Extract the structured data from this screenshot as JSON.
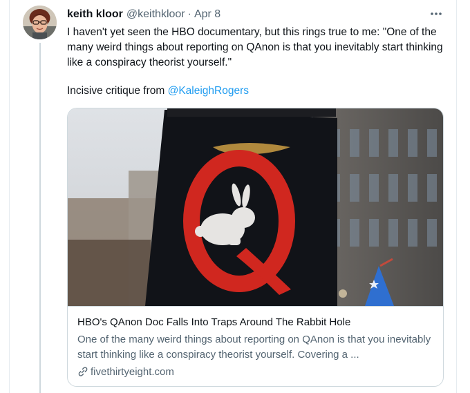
{
  "tweet": {
    "display_name": "keith kloor",
    "handle": "@keithkloor",
    "separator": "·",
    "date": "Apr 8",
    "more_icon": "more-horizontal-icon",
    "text": "I haven't yet seen the HBO documentary, but this rings  true to me: \"One of the many weird things about reporting on QAnon is that you inevitably start thinking like a conspiracy theorist yourself.\"",
    "critique_prefix": "Incisive critique from ",
    "mention": "@KaleighRogers"
  },
  "card": {
    "title": "HBO's QAnon Doc Falls Into Traps Around The Rabbit Hole",
    "description": "One of the many weird things about reporting on QAnon is that you inevitably start thinking like a conspiracy theorist yourself. Covering a ...",
    "domain": "fivethirtyeight.com",
    "link_icon": "link-icon"
  },
  "colors": {
    "link_blue": "#1d9bf0",
    "text_primary": "#0f1419",
    "text_secondary": "#536471",
    "border": "#cfd9de",
    "flag_black": "#111318",
    "q_red": "#d0271f"
  }
}
